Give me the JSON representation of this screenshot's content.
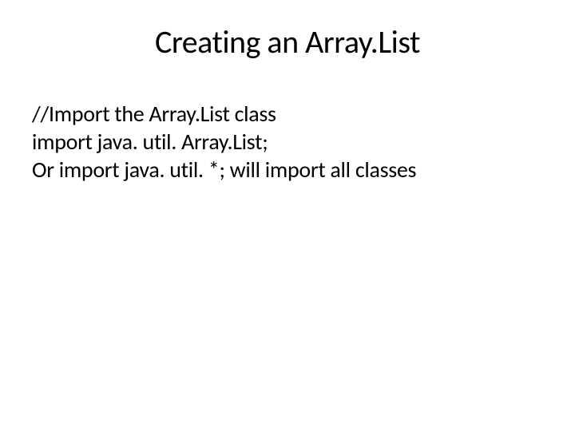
{
  "slide": {
    "title": "Creating an Array.List",
    "lines": [
      "//Import the Array.List class",
      "import java. util. Array.List;",
      "Or import java. util. *;   will import all classes"
    ]
  }
}
